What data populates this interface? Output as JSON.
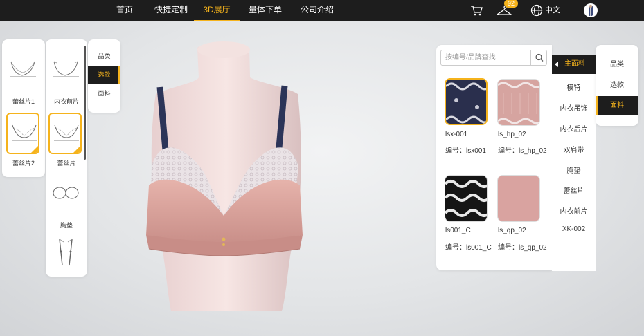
{
  "nav": {
    "items": [
      "首页",
      "快捷定制",
      "3D展厅",
      "量体下单",
      "公司介绍"
    ],
    "active_index": 2,
    "cart_badge": "92",
    "language": "中文",
    "accent": "#f5b31c"
  },
  "left": {
    "parts_col1": [
      {
        "label": "蕾丝片1",
        "icon": "bra-outline-icon",
        "selected": false
      },
      {
        "label": "蕾丝片2",
        "icon": "lace-cup-icon",
        "selected": true
      }
    ],
    "parts_col2": [
      {
        "label": "内衣前片",
        "icon": "bra-front-icon",
        "selected": false
      },
      {
        "label": "蕾丝片",
        "icon": "lace-cup-icon",
        "selected": true
      },
      {
        "label": "胸垫",
        "icon": "pad-icon",
        "selected": false
      },
      {
        "label": "",
        "icon": "strap-icon",
        "selected": false
      }
    ],
    "tabs": [
      "品类",
      "选款",
      "面料"
    ],
    "active_tab": 1
  },
  "right": {
    "search": {
      "placeholder": "按编号/品牌查找"
    },
    "code_prefix": "编号：",
    "fabrics": [
      {
        "name": "lsx-001",
        "code": "lsx001",
        "swatch": "navy-lace",
        "selected": true
      },
      {
        "name": "ls_hp_02",
        "code": "ls_hp_02",
        "swatch": "pink-lace",
        "selected": false
      },
      {
        "name": "ls001_C",
        "code": "ls001_C",
        "swatch": "black-lace",
        "selected": false
      },
      {
        "name": "ls_qp_02",
        "code": "ls_qp_02",
        "swatch": "pink-plain",
        "selected": false
      }
    ],
    "categories": [
      "主面料",
      "模特",
      "内衣吊饰",
      "内衣后片",
      "双肩带",
      "胸垫",
      "蕾丝片",
      "内衣前片",
      "XK-002"
    ],
    "active_category": 0,
    "tabs": [
      "品类",
      "选款",
      "面料"
    ],
    "active_tab": 2
  }
}
